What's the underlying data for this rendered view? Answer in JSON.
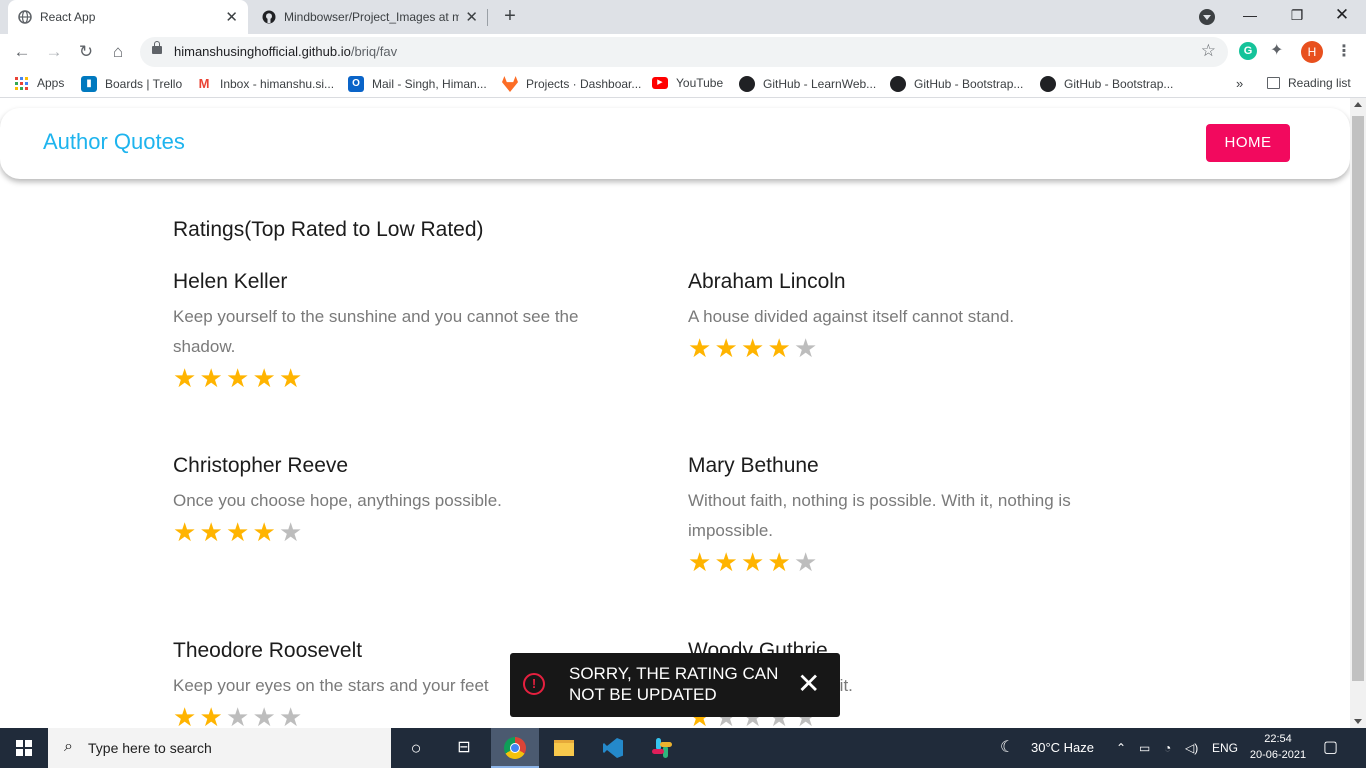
{
  "browser": {
    "tabs": [
      {
        "title": "React App",
        "active": true
      },
      {
        "title": "Mindbowser/Project_Images at m",
        "active": false
      }
    ],
    "url": {
      "host": "himanshusinghofficial.github.io",
      "path": "/briq/fav"
    },
    "profile_initial": "H",
    "extension_initial": "G",
    "bookmarks": [
      {
        "label": "Apps",
        "icon": "apps-grid-icon"
      },
      {
        "label": "Boards | Trello",
        "icon": "trello-icon"
      },
      {
        "label": "Inbox - himanshu.si...",
        "icon": "gmail-icon"
      },
      {
        "label": "Mail - Singh, Himan...",
        "icon": "outlook-icon"
      },
      {
        "label": "Projects · Dashboar...",
        "icon": "gitlab-icon"
      },
      {
        "label": "YouTube",
        "icon": "youtube-icon"
      },
      {
        "label": "GitHub - LearnWeb...",
        "icon": "github-icon"
      },
      {
        "label": "GitHub - Bootstrap...",
        "icon": "github-icon"
      },
      {
        "label": "GitHub - Bootstrap...",
        "icon": "github-icon"
      }
    ],
    "overflow_label": "»",
    "reading_list": "Reading list"
  },
  "app": {
    "title": "Author Quotes",
    "home_button": "HOME",
    "heading": "Ratings(Top Rated to Low Rated)",
    "colors": {
      "title": "#1eb4ee",
      "home_button": "#f2095e",
      "star_on": "#ffb400",
      "star_off": "#bdbdbd"
    },
    "quotes": [
      {
        "author": "Helen Keller",
        "quote": "Keep yourself to the sunshine and you cannot see the shadow.",
        "rating": 5
      },
      {
        "author": "Abraham Lincoln",
        "quote": "A house divided against itself cannot stand.",
        "rating": 4
      },
      {
        "author": "Christopher Reeve",
        "quote": "Once you choose hope, anythings possible.",
        "rating": 4
      },
      {
        "author": "Mary Bethune",
        "quote": "Without faith, nothing is possible. With it, nothing is impossible.",
        "rating": 4
      },
      {
        "author": "Theodore Roosevelt",
        "quote": "Keep your eyes on the stars and your feet",
        "rating": 2
      },
      {
        "author": "Woody Guthrie",
        "quote": "ke it.",
        "rating": 1
      }
    ],
    "max_rating": 5
  },
  "snackbar": {
    "message": "SORRY, THE RATING CAN NOT BE UPDATED",
    "icon": "error-icon",
    "close_icon": "close-icon"
  },
  "taskbar": {
    "search_placeholder": "Type here to search",
    "weather": "30°C  Haze",
    "language": "ENG",
    "time": "22:54",
    "date": "20-06-2021"
  }
}
